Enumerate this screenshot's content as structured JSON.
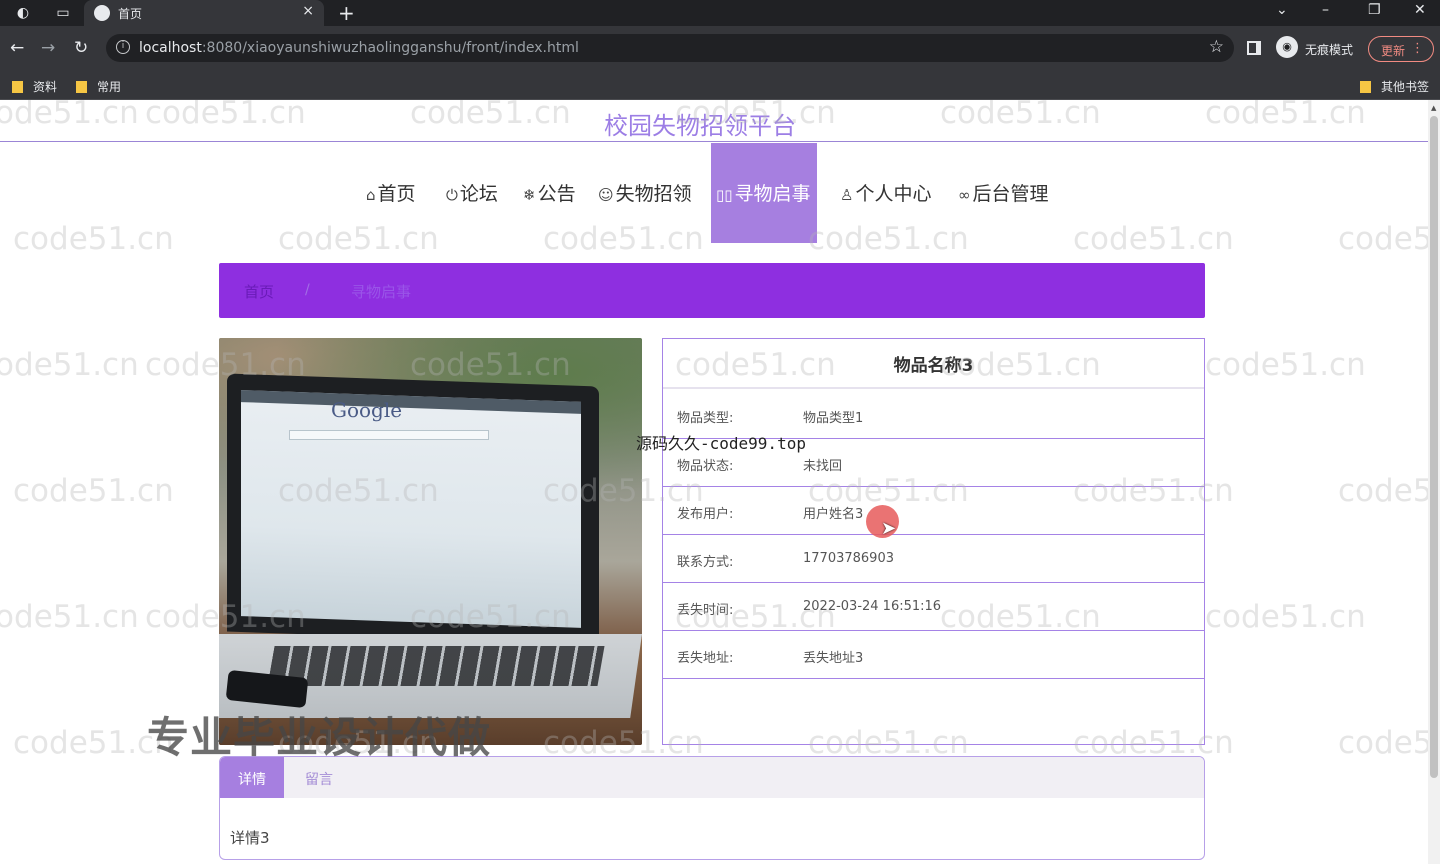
{
  "browser": {
    "tab_title": "首页",
    "tab_close": "×",
    "new_tab": "+",
    "url_host": "localhost",
    "url_rest": ":8080/xiaoyaunshiwuzhaolingganshu/front/index.html",
    "incognito_label": "无痕模式",
    "update_label": "更新",
    "bookmarks": [
      "资料",
      "常用"
    ],
    "other_bookmarks": "其他书签"
  },
  "site": {
    "title": "校园失物招领平台"
  },
  "nav": {
    "items": [
      {
        "icon": "home-icon",
        "glyph": "⌂",
        "label": "首页"
      },
      {
        "icon": "power-icon",
        "glyph": "⏻",
        "label": "论坛"
      },
      {
        "icon": "snowflake-icon",
        "glyph": "❄",
        "label": "公告"
      },
      {
        "icon": "palette-icon",
        "glyph": "☺",
        "label": "失物招领"
      },
      {
        "icon": "glasses-icon",
        "glyph": "▯▯",
        "label": "寻物启事"
      },
      {
        "icon": "user-icon",
        "glyph": "♙",
        "label": "个人中心"
      },
      {
        "icon": "link-icon",
        "glyph": "∞",
        "label": "后台管理"
      }
    ],
    "active_index": 4
  },
  "breadcrumb": {
    "home": "首页",
    "separator": "/",
    "current": "寻物启事"
  },
  "item": {
    "name": "物品名称3",
    "fields": [
      {
        "label": "物品类型:",
        "value": "物品类型1"
      },
      {
        "label": "物品状态:",
        "value": "未找回"
      },
      {
        "label": "发布用户:",
        "value": "用户姓名3"
      },
      {
        "label": "联系方式:",
        "value": "17703786903"
      },
      {
        "label": "丢失时间:",
        "value": "2022-03-24 16:51:16"
      },
      {
        "label": "丢失地址:",
        "value": "丢失地址3"
      }
    ],
    "photo_text": "Google"
  },
  "tabs": {
    "detail_label": "详情",
    "comment_label": "留言",
    "detail_content": "详情3"
  },
  "overlays": {
    "watermark": "code51.cn",
    "source_banner": "源码久久-code99.top",
    "ad_text": "专业毕业设计代做"
  },
  "colors": {
    "accent": "#a67fe0",
    "breadcrumb_bg": "#8e2fe0",
    "border": "#a583e6"
  }
}
